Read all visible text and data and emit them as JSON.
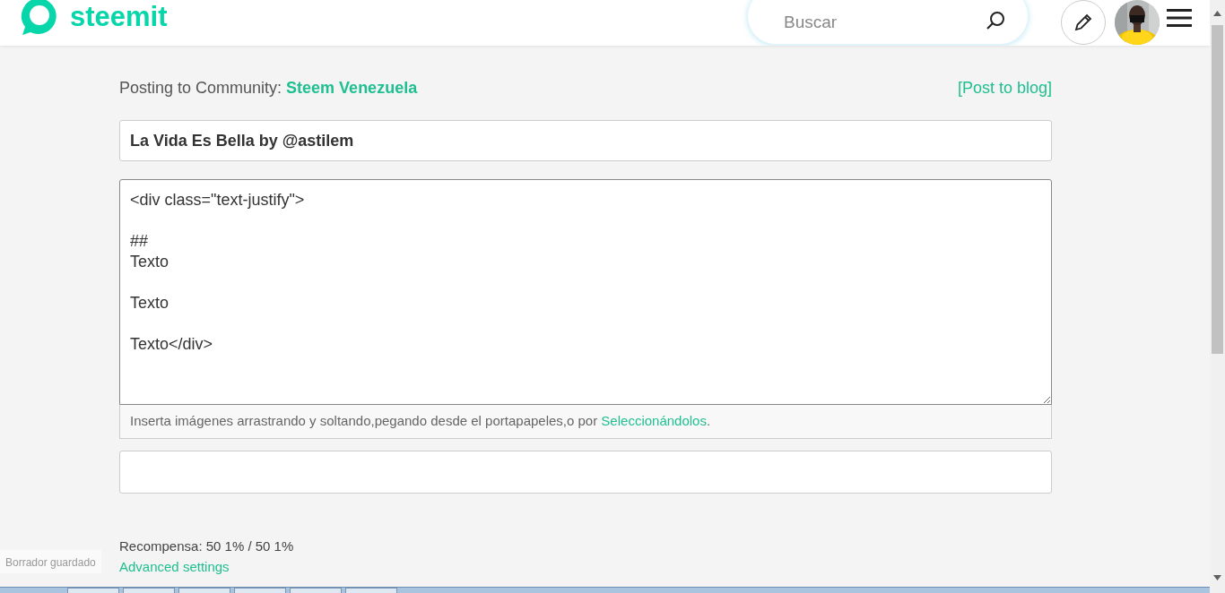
{
  "header": {
    "logo_text": "steemit",
    "search": {
      "placeholder": "Buscar"
    }
  },
  "composer": {
    "posting_label": "Posting to Community:",
    "community": "Steem Venezuela",
    "post_to_blog": "[Post to blog]",
    "title_value": "La Vida Es Bella by @astilem",
    "body_value": "<div class=\"text-justify\">\n\n##\nTexto\n\nTexto\n\nTexto</div>",
    "upload_hint": "Inserta imágenes arrastrando y soltando,pegando desde el portapapeles,o por ",
    "upload_link": "Seleccionándolos",
    "upload_end": ".",
    "reward_label": "Recompensa:",
    "reward_value": "50 1% / 50 1%",
    "advanced_settings": "Advanced settings"
  },
  "toast": "Borrador guardado"
}
